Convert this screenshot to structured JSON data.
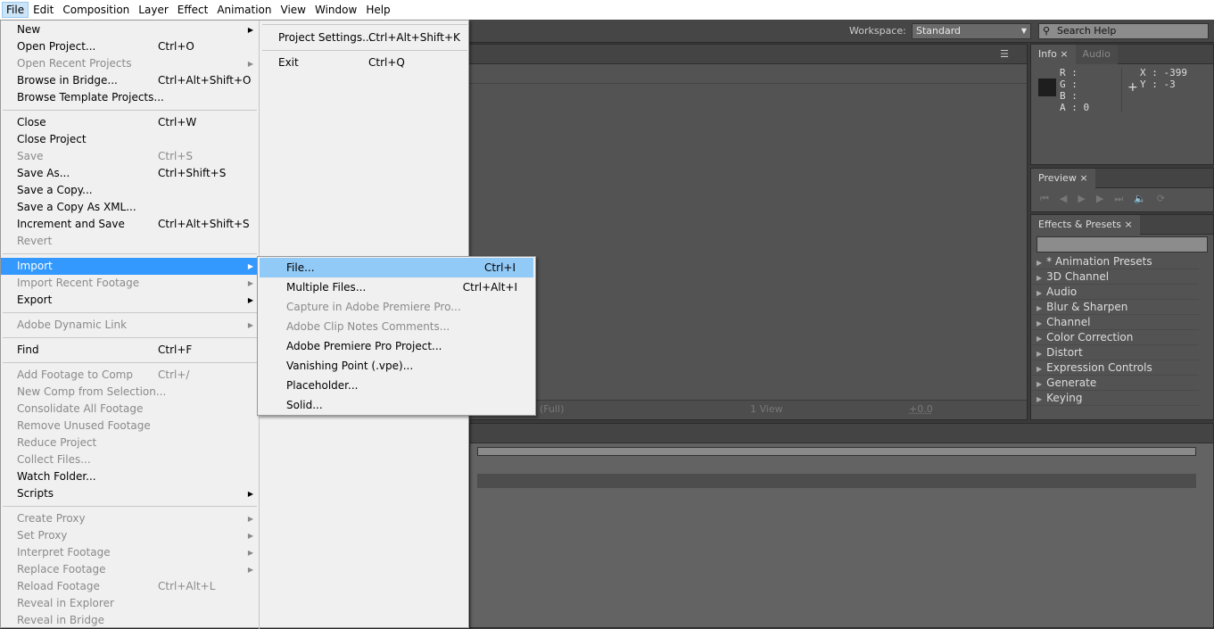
{
  "menubar": [
    "File",
    "Edit",
    "Composition",
    "Layer",
    "Effect",
    "Animation",
    "View",
    "Window",
    "Help"
  ],
  "file_menu": {
    "col1": [
      {
        "label": "New",
        "arrow": true
      },
      {
        "label": "Open Project...",
        "shortcut": "Ctrl+O"
      },
      {
        "label": "Open Recent Projects",
        "disabled": true,
        "arrow": true
      },
      {
        "label": "Browse in Bridge...",
        "shortcut": "Ctrl+Alt+Shift+O"
      },
      {
        "label": "Browse Template Projects..."
      },
      {
        "sep": true
      },
      {
        "label": "Close",
        "shortcut": "Ctrl+W"
      },
      {
        "label": "Close Project"
      },
      {
        "label": "Save",
        "shortcut": "Ctrl+S",
        "disabled": true
      },
      {
        "label": "Save As...",
        "shortcut": "Ctrl+Shift+S"
      },
      {
        "label": "Save a Copy..."
      },
      {
        "label": "Save a Copy As XML..."
      },
      {
        "label": "Increment and Save",
        "shortcut": "Ctrl+Alt+Shift+S"
      },
      {
        "label": "Revert",
        "disabled": true
      },
      {
        "sep": true
      },
      {
        "label": "Import",
        "arrow": true,
        "highlighted": true
      },
      {
        "label": "Import Recent Footage",
        "disabled": true,
        "arrow": true
      },
      {
        "label": "Export",
        "arrow": true
      },
      {
        "sep": true
      },
      {
        "label": "Adobe Dynamic Link",
        "disabled": true,
        "arrow": true
      },
      {
        "sep": true
      },
      {
        "label": "Find",
        "shortcut": "Ctrl+F"
      },
      {
        "sep": true
      },
      {
        "label": "Add Footage to Comp",
        "shortcut": "Ctrl+/",
        "disabled": true
      },
      {
        "label": "New Comp from Selection...",
        "disabled": true
      },
      {
        "label": "Consolidate All Footage",
        "disabled": true
      },
      {
        "label": "Remove Unused Footage",
        "disabled": true
      },
      {
        "label": "Reduce Project",
        "disabled": true
      },
      {
        "label": "Collect Files...",
        "disabled": true
      },
      {
        "label": "Watch Folder..."
      },
      {
        "label": "Scripts",
        "arrow": true
      },
      {
        "sep": true
      },
      {
        "label": "Create Proxy",
        "disabled": true,
        "arrow": true
      },
      {
        "label": "Set Proxy",
        "disabled": true,
        "arrow": true
      },
      {
        "label": "Interpret Footage",
        "disabled": true,
        "arrow": true
      },
      {
        "label": "Replace Footage",
        "disabled": true,
        "arrow": true
      },
      {
        "label": "Reload Footage",
        "shortcut": "Ctrl+Alt+L",
        "disabled": true
      },
      {
        "label": "Reveal in Explorer",
        "disabled": true
      },
      {
        "label": "Reveal in Bridge",
        "disabled": true
      }
    ],
    "col2": [
      {
        "label": "Project Settings...",
        "shortcut": "Ctrl+Alt+Shift+K"
      },
      {
        "label": "Exit",
        "shortcut": "Ctrl+Q"
      }
    ]
  },
  "import_submenu": [
    {
      "label": "File...",
      "shortcut": "Ctrl+I",
      "highlighted": true
    },
    {
      "label": "Multiple Files...",
      "shortcut": "Ctrl+Alt+I"
    },
    {
      "label": "Capture in Adobe Premiere Pro...",
      "disabled": true
    },
    {
      "label": "Adobe Clip Notes Comments...",
      "disabled": true
    },
    {
      "label": "Adobe Premiere Pro Project..."
    },
    {
      "label": "Vanishing Point (.vpe)..."
    },
    {
      "label": "Placeholder..."
    },
    {
      "label": "Solid..."
    }
  ],
  "toolbar": {
    "workspace_label": "Workspace:",
    "workspace_value": "Standard",
    "search_placeholder": "Search Help"
  },
  "info_panel": {
    "tab": "Info",
    "tab2": "Audio",
    "r": "R :",
    "g": "G :",
    "b": "B :",
    "a": "A : 0",
    "x": "X : -399",
    "y": "Y : -3"
  },
  "preview_panel": {
    "tab": "Preview"
  },
  "effects_panel": {
    "tab": "Effects & Presets",
    "items": [
      "* Animation Presets",
      "3D Channel",
      "Audio",
      "Blur & Sharpen",
      "Channel",
      "Color Correction",
      "Distort",
      "Expression Controls",
      "Generate",
      "Keying"
    ]
  },
  "comp_toolbar": {
    "resolution": "(Full)",
    "views": "1 View",
    "exposure": "+0.0"
  }
}
